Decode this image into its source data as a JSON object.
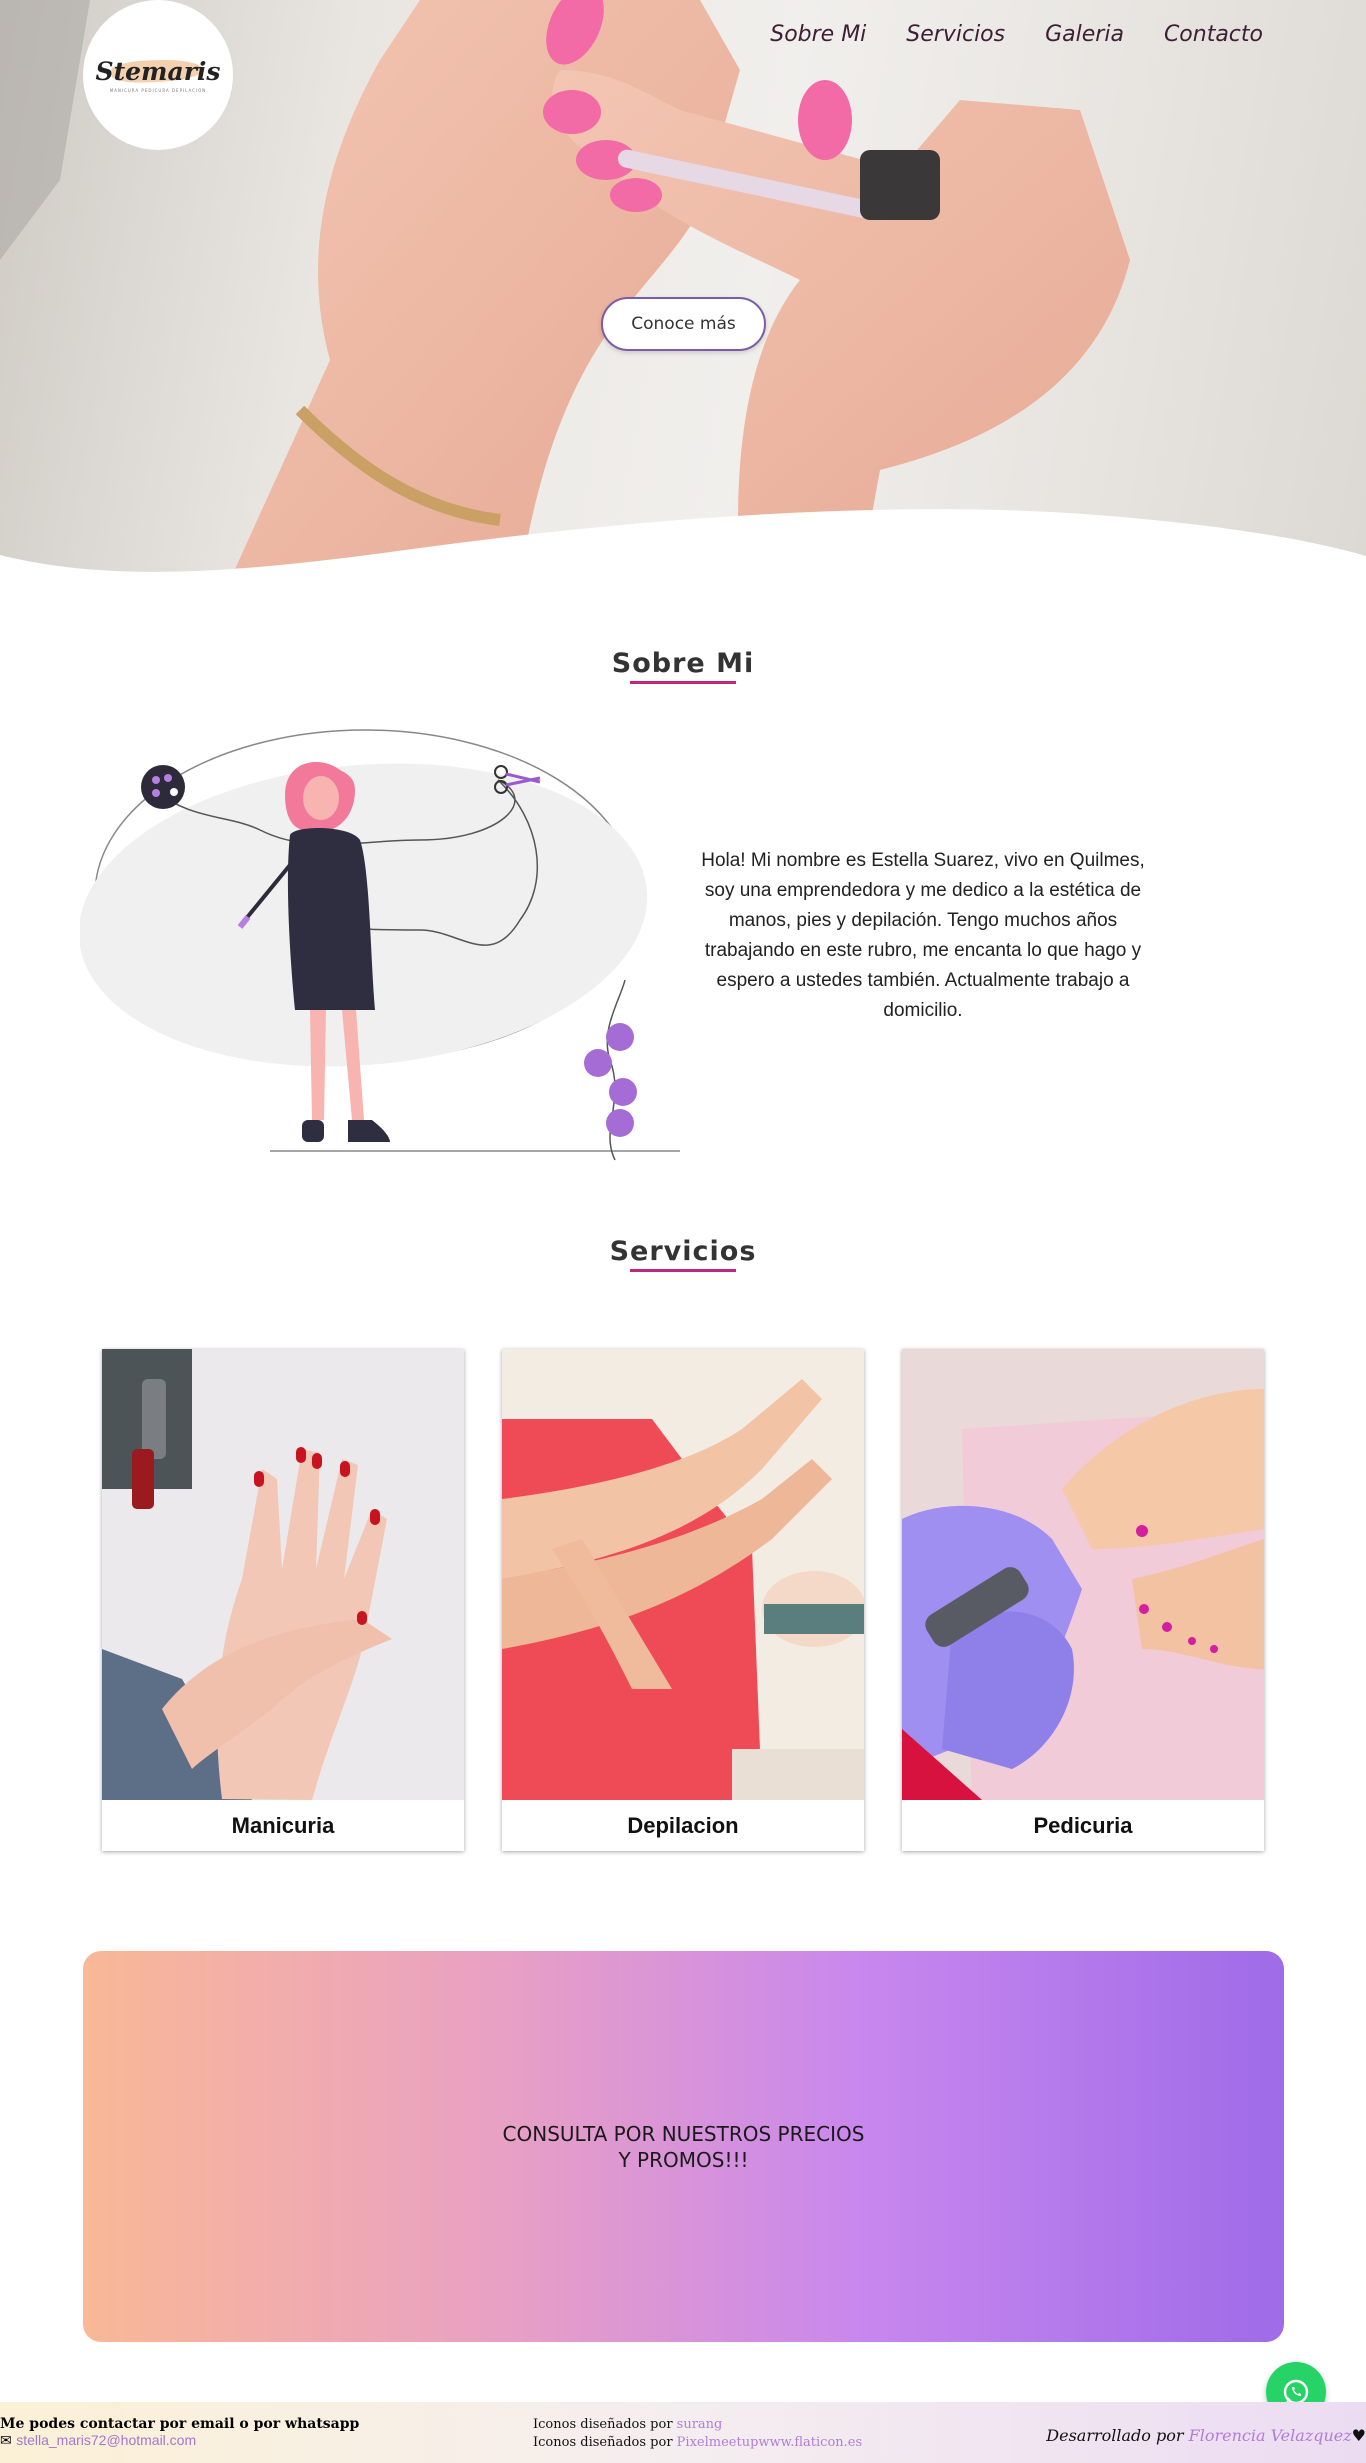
{
  "brand": {
    "name": "Stemaris",
    "tagline": "MANICURA PEDICURA DEPILACION"
  },
  "nav": {
    "items": [
      "Sobre Mi",
      "Servicios",
      "Galeria",
      "Contacto"
    ]
  },
  "hero": {
    "cta_label": "Conoce más"
  },
  "about": {
    "title": "Sobre Mi",
    "text": "Hola! Mi nombre es Estella Suarez, vivo en Quilmes, soy una emprendedora y me dedico a la estética de manos, pies y depilación. Tengo muchos años trabajando en este rubro, me encanta lo que hago y espero a ustedes también. Actualmente trabajo a domicilio."
  },
  "services": {
    "title": "Servicios",
    "items": [
      "Manicuria",
      "Depilacion",
      "Pedicuria"
    ]
  },
  "promo": {
    "text": "CONSULTA POR NUESTROS PRECIOS Y PROMOS!!!"
  },
  "footer": {
    "contact_title": "Me podes contactar por email o por whatsapp",
    "email": "stella_maris72@hotmail.com",
    "credit1_prefix": "Iconos diseñados por ",
    "credit1_link": "surang",
    "credit2_prefix": "Iconos diseñados por ",
    "credit2_link": "Pixelmeetupwww.flaticon.es",
    "dev_prefix": "Desarrollado por ",
    "dev_link": "Florencia Velazquez",
    "heart": "♥"
  },
  "colors": {
    "accent": "#c0267e",
    "nav_text": "#3d1f35",
    "whatsapp": "#25d366",
    "link": "#b27cd6"
  }
}
